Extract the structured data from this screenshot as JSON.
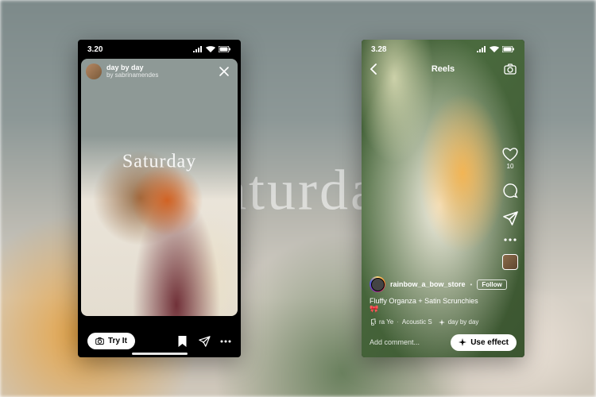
{
  "background": {
    "overlay_word": "Saturday"
  },
  "left_phone": {
    "status": {
      "time": "3.20"
    },
    "story": {
      "track_title": "day by day",
      "track_artist": "by sabrinamendes",
      "overlay_text": "Saturday"
    },
    "actions": {
      "try_it": "Try It",
      "camera_icon": "camera-icon",
      "bookmark_icon": "bookmark-icon",
      "share_icon": "share-icon",
      "more_icon": "more-icon"
    }
  },
  "right_phone": {
    "status": {
      "time": "3.28"
    },
    "header": {
      "title": "Reels"
    },
    "rail": {
      "like_count": "10",
      "comment_count": "",
      "share_count": ""
    },
    "meta": {
      "username": "rainbow_a_bow_store",
      "follow": "Follow",
      "caption": "Fluffy Organza + Satin  Scrunchies 🎀",
      "audio_artist": "ra Ye",
      "audio_album": "Acoustic S",
      "audio_effect": "day by day"
    },
    "bottom": {
      "comment_placeholder": "Add comment...",
      "use_effect": "Use effect"
    }
  }
}
